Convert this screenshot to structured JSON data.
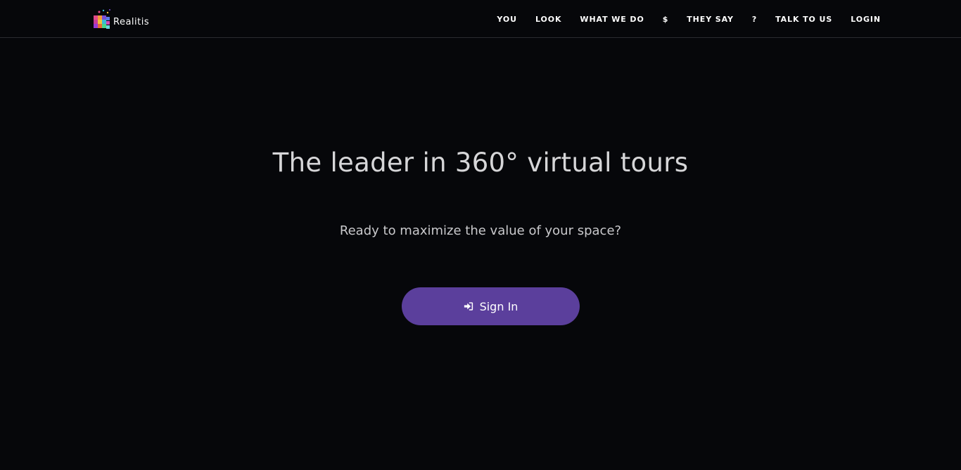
{
  "brand": {
    "name": "Realitis",
    "logo_icon": "cube-logo-icon"
  },
  "nav": {
    "items": [
      {
        "label": "YOU"
      },
      {
        "label": "LOOK"
      },
      {
        "label": "WHAT WE DO"
      },
      {
        "label": "$"
      },
      {
        "label": "THEY SAY"
      },
      {
        "label": "?"
      },
      {
        "label": "TALK TO US"
      },
      {
        "label": "LOGIN"
      }
    ]
  },
  "hero": {
    "title": "The leader in 360° virtual tours",
    "subtitle": "Ready to maximize the value of your space?",
    "cta": {
      "label": "Sign In",
      "icon": "sign-in-icon"
    }
  },
  "colors": {
    "background": "#06070a",
    "accent": "#5b3f9c",
    "text": "#d6d6d8"
  }
}
